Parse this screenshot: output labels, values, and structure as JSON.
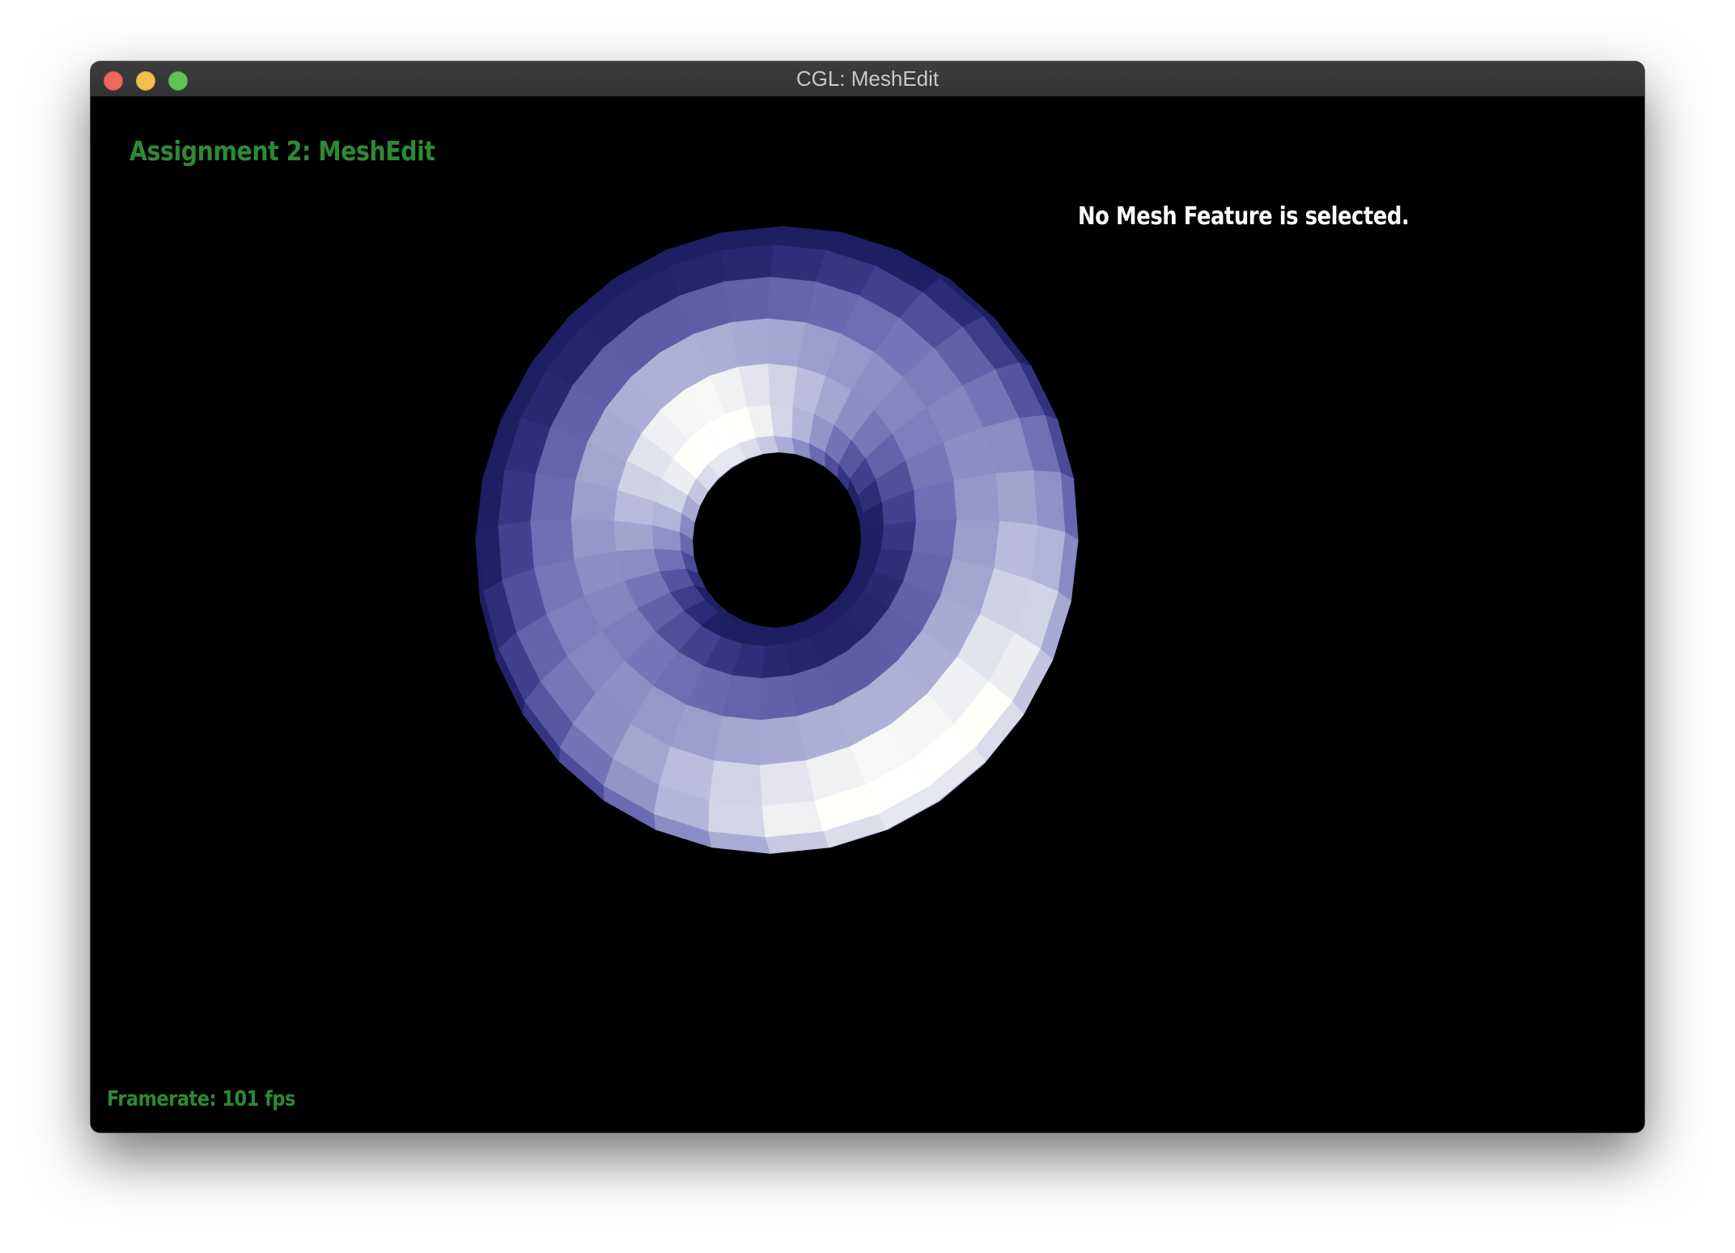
{
  "window": {
    "title": "CGL: MeshEdit"
  },
  "viewport": {
    "heading": "Assignment 2: MeshEdit",
    "status": "No Mesh Feature is selected.",
    "framerate": "Framerate: 101 fps",
    "heading_color": "#2d8a34",
    "background_color": "#000000"
  },
  "mesh": {
    "shape": "torus",
    "base_color": "#9a9cff"
  }
}
